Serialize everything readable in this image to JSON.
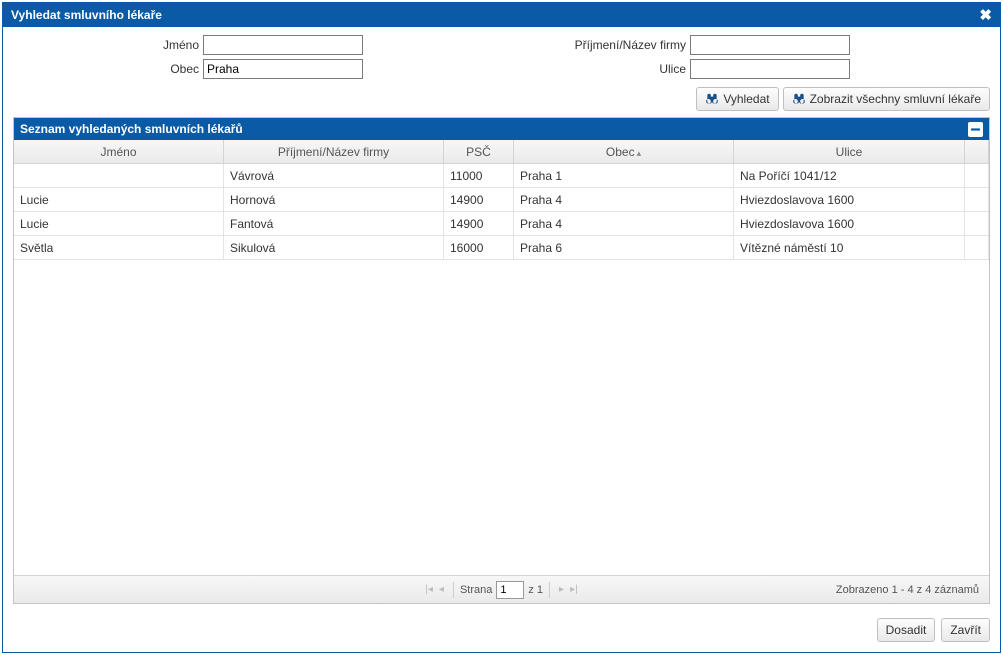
{
  "dialog": {
    "title": "Vyhledat smluvního lékaře"
  },
  "form": {
    "jmeno_label": "Jméno",
    "jmeno_value": "",
    "prijmeni_label": "Příjmení/Název firmy",
    "prijmeni_value": "",
    "obec_label": "Obec",
    "obec_value": "Praha",
    "ulice_label": "Ulice",
    "ulice_value": ""
  },
  "buttons": {
    "search": "Vyhledat",
    "show_all": "Zobrazit všechny smluvní lékaře",
    "insert": "Dosadit",
    "close": "Zavřít"
  },
  "results_panel": {
    "title": "Seznam vyhledaných smluvních lékařů"
  },
  "columns": {
    "jmeno": "Jméno",
    "prijmeni": "Příjmení/Název firmy",
    "psc": "PSČ",
    "obec": "Obec",
    "ulice": "Ulice"
  },
  "rows": [
    {
      "jmeno": "",
      "prijmeni": "Vávrová",
      "psc": "11000",
      "obec": "Praha 1",
      "ulice": "Na Poříčí 1041/12"
    },
    {
      "jmeno": "Lucie",
      "prijmeni": "Hornová",
      "psc": "14900",
      "obec": "Praha 4",
      "ulice": "Hviezdoslavova 1600"
    },
    {
      "jmeno": "Lucie",
      "prijmeni": "Fantová",
      "psc": "14900",
      "obec": "Praha 4",
      "ulice": "Hviezdoslavova 1600"
    },
    {
      "jmeno": "Světla",
      "prijmeni": "Sikulová",
      "psc": "16000",
      "obec": "Praha 6",
      "ulice": "Vítězné náměstí 10"
    }
  ],
  "pager": {
    "page_label_prefix": "Strana",
    "page_value": "1",
    "page_label_suffix": "z 1",
    "status": "Zobrazeno 1 - 4 z 4 záznamů"
  }
}
